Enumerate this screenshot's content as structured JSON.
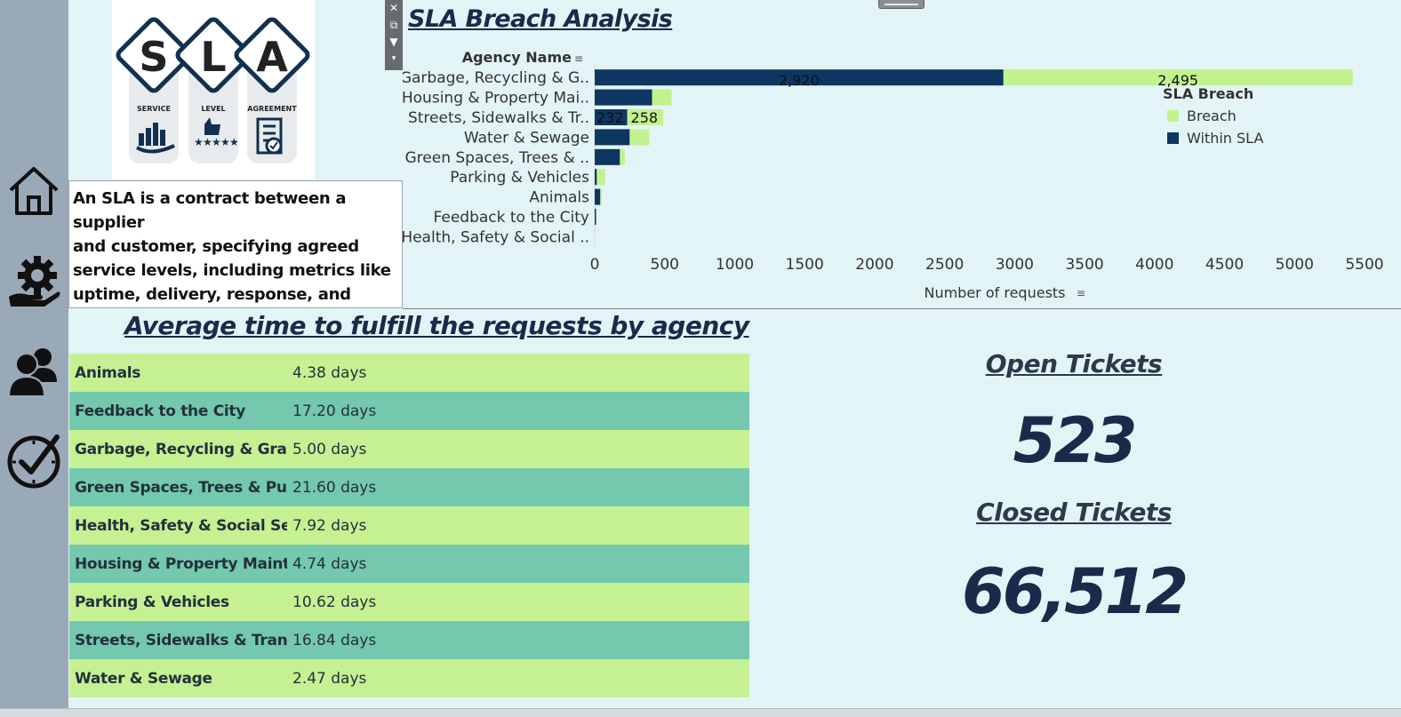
{
  "logo": {
    "letters": [
      "S",
      "L",
      "A"
    ],
    "captions": [
      "SERVICE",
      "LEVEL",
      "AGREEMENT"
    ]
  },
  "description": "An SLA is a contract between a supplier\nand customer, specifying agreed\nservice levels, including metrics like\nuptime, delivery, response, and\nresolution times. It also outlines actio..",
  "nav": {
    "items": [
      "home-icon",
      "gear-hand-icon",
      "users-icon",
      "check-clock-icon"
    ]
  },
  "toolbar": {
    "icons": [
      "close-icon",
      "popout-icon",
      "filter-icon",
      "dropdown-icon"
    ]
  },
  "chart": {
    "title": "SLA Breach Analysis",
    "y_header": "Agency Name",
    "x_label": "Number of requests",
    "legend_title": "SLA Breach",
    "legend": [
      {
        "label": "Breach",
        "color": "#c3f18f"
      },
      {
        "label": "Within SLA",
        "color": "#0d3660"
      }
    ]
  },
  "chart_data": {
    "type": "bar",
    "orientation": "horizontal",
    "stacked": true,
    "title": "SLA Breach Analysis",
    "xlabel": "Number of requests",
    "ylabel": "Agency Name",
    "xlim": [
      0,
      5500
    ],
    "xticks": [
      0,
      500,
      1000,
      1500,
      2000,
      2500,
      3000,
      3500,
      4000,
      4500,
      5000,
      5500
    ],
    "categories": [
      "Garbage, Recycling & G..",
      "Housing & Property Mai..",
      "Streets, Sidewalks & Tr..",
      "Water & Sewage",
      "Green Spaces, Trees & ..",
      "Parking & Vehicles",
      "Animals",
      "Feedback to the City",
      "Health, Safety & Social .."
    ],
    "series": [
      {
        "name": "Within SLA",
        "color": "#0d3660",
        "values": [
          2920,
          410,
          232,
          250,
          180,
          15,
          40,
          5,
          0
        ],
        "labels": [
          "2,920",
          "",
          "232",
          "",
          "",
          "",
          "",
          "",
          ""
        ]
      },
      {
        "name": "Breach",
        "color": "#c3f18f",
        "values": [
          2495,
          140,
          258,
          140,
          35,
          60,
          5,
          0,
          0
        ],
        "labels": [
          "2,495",
          "",
          "258",
          "",
          "",
          "",
          "",
          "",
          ""
        ]
      }
    ],
    "legend": "right",
    "grid": false
  },
  "avg": {
    "title": "Average time to fulfill the requests by agency",
    "rows": [
      {
        "agency": "Animals",
        "value": "4.38 days"
      },
      {
        "agency": "Feedback to the City",
        "value": "17.20 days"
      },
      {
        "agency": "Garbage, Recycling & Graffi..",
        "value": "5.00 days"
      },
      {
        "agency": "Green Spaces, Trees & Publ..",
        "value": "21.60 days"
      },
      {
        "agency": "Health, Safety & Social Ser..",
        "value": "7.92 days"
      },
      {
        "agency": "Housing & Property Mainte..",
        "value": "4.74 days"
      },
      {
        "agency": "Parking & Vehicles",
        "value": "10.62 days"
      },
      {
        "agency": "Streets, Sidewalks & Trans..",
        "value": "16.84 days"
      },
      {
        "agency": "Water & Sewage",
        "value": "2.47 days"
      }
    ]
  },
  "kpis": {
    "open_label": "Open Tickets",
    "open_value": "523",
    "closed_label": "Closed Tickets",
    "closed_value": "66,512"
  }
}
